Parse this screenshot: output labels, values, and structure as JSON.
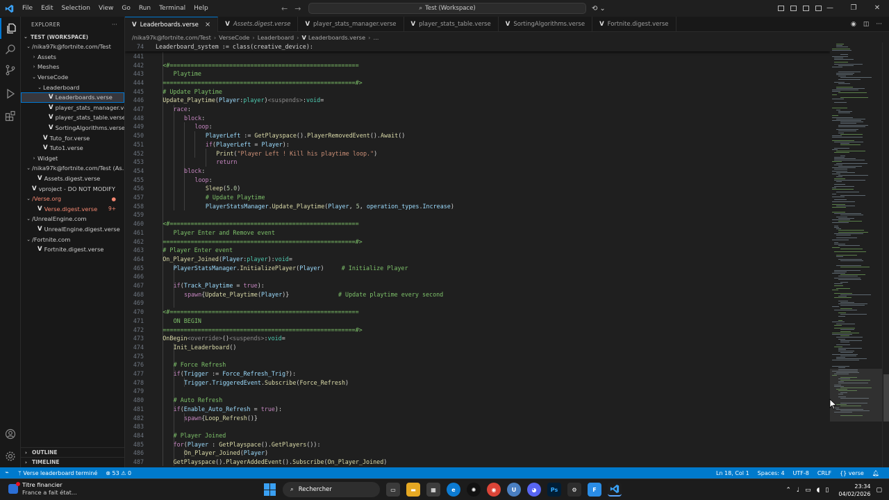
{
  "menu": [
    "File",
    "Edit",
    "Selection",
    "View",
    "Go",
    "Run",
    "Terminal",
    "Help"
  ],
  "search": {
    "text": "Test (Workspace)"
  },
  "sidebar": {
    "title": "EXPLORER",
    "more": "···",
    "workspace": "TEST (WORKSPACE)",
    "items": [
      {
        "label": "/nika97k@fortnite.com/Test",
        "indent": 1,
        "twisty": "open",
        "v": false
      },
      {
        "label": "Assets",
        "indent": 2,
        "twisty": "closed",
        "v": false
      },
      {
        "label": "Meshes",
        "indent": 2,
        "twisty": "closed",
        "v": false
      },
      {
        "label": "VerseCode",
        "indent": 2,
        "twisty": "open",
        "v": false
      },
      {
        "label": "Leaderboard",
        "indent": 3,
        "twisty": "open",
        "v": false
      },
      {
        "label": "Leaderboards.verse",
        "indent": 4,
        "twisty": "",
        "v": true,
        "selected": true
      },
      {
        "label": "player_stats_manager.verse",
        "indent": 4,
        "twisty": "",
        "v": true
      },
      {
        "label": "player_stats_table.verse",
        "indent": 4,
        "twisty": "",
        "v": true
      },
      {
        "label": "SortingAlgorithms.verse",
        "indent": 4,
        "twisty": "",
        "v": true
      },
      {
        "label": "Tuto_for.verse",
        "indent": 3,
        "twisty": "",
        "v": true
      },
      {
        "label": "Tuto1.verse",
        "indent": 3,
        "twisty": "",
        "v": true
      },
      {
        "label": "Widget",
        "indent": 2,
        "twisty": "closed",
        "v": false
      },
      {
        "label": "/nika97k@fortnite.com/Test (As...",
        "indent": 1,
        "twisty": "open",
        "v": false
      },
      {
        "label": "Assets.digest.verse",
        "indent": 2,
        "twisty": "",
        "v": true
      },
      {
        "label": "vproject - DO NOT MODIFY",
        "indent": 1,
        "twisty": "",
        "v": true
      },
      {
        "label": "/Verse.org",
        "indent": 1,
        "twisty": "open",
        "v": false,
        "error": true,
        "badge": "●"
      },
      {
        "label": "Verse.digest.verse",
        "indent": 2,
        "twisty": "",
        "v": true,
        "error": true,
        "badge": "9+"
      },
      {
        "label": "/UnrealEngine.com",
        "indent": 1,
        "twisty": "open",
        "v": false
      },
      {
        "label": "UnrealEngine.digest.verse",
        "indent": 2,
        "twisty": "",
        "v": true
      },
      {
        "label": "/Fortnite.com",
        "indent": 1,
        "twisty": "open",
        "v": false
      },
      {
        "label": "Fortnite.digest.verse",
        "indent": 2,
        "twisty": "",
        "v": true
      }
    ],
    "outline": "OUTLINE",
    "timeline": "TIMELINE"
  },
  "tabs": [
    {
      "label": "Leaderboards.verse",
      "active": true,
      "italic": false
    },
    {
      "label": "Assets.digest.verse",
      "active": false,
      "italic": true
    },
    {
      "label": "player_stats_manager.verse",
      "active": false,
      "italic": false
    },
    {
      "label": "player_stats_table.verse",
      "active": false,
      "italic": false
    },
    {
      "label": "SortingAlgorithms.verse",
      "active": false,
      "italic": false
    },
    {
      "label": "Fortnite.digest.verse",
      "active": false,
      "italic": false
    }
  ],
  "breadcrumb": [
    "/nika97k@fortnite.com/Test",
    "VerseCode",
    "Leaderboard",
    "Leaderboards.verse",
    "..."
  ],
  "sticky": {
    "num": "74",
    "code": "Leaderboard_system := class(creative_device):"
  },
  "lines": [
    {
      "n": "441",
      "t": [],
      "i": 0
    },
    {
      "n": "442",
      "t": [
        [
          "g",
          "<#======================================================"
        ]
      ],
      "i": 2
    },
    {
      "n": "443",
      "t": [
        [
          "g",
          "Playtime"
        ]
      ],
      "i": 5
    },
    {
      "n": "444",
      "t": [
        [
          "g",
          "=======================================================#>"
        ]
      ],
      "i": 2
    },
    {
      "n": "445",
      "t": [
        [
          "g",
          "# Update Playtime"
        ]
      ],
      "i": 2
    },
    {
      "n": "446",
      "t": [
        [
          "y",
          "Update_Playtime"
        ],
        [
          "w",
          "("
        ],
        [
          "c",
          "Player"
        ],
        [
          "w",
          ":"
        ],
        [
          "t",
          "player"
        ],
        [
          "w",
          ")"
        ],
        [
          "q",
          "<suspends>"
        ],
        [
          "w",
          ":"
        ],
        [
          "t",
          "void"
        ],
        [
          "w",
          "="
        ]
      ],
      "i": 2
    },
    {
      "n": "447",
      "t": [
        [
          "k",
          "race"
        ],
        [
          "w",
          ":"
        ]
      ],
      "i": 5
    },
    {
      "n": "448",
      "t": [
        [
          "k",
          "block"
        ],
        [
          "w",
          ":"
        ]
      ],
      "i": 8
    },
    {
      "n": "449",
      "t": [
        [
          "k",
          "loop"
        ],
        [
          "w",
          ":"
        ]
      ],
      "i": 11
    },
    {
      "n": "450",
      "t": [
        [
          "c",
          "PlayerLeft"
        ],
        [
          "w",
          " := "
        ],
        [
          "y",
          "GetPlayspace"
        ],
        [
          "w",
          "()."
        ],
        [
          "y",
          "PlayerRemovedEvent"
        ],
        [
          "w",
          "()."
        ],
        [
          "y",
          "Await"
        ],
        [
          "w",
          "()"
        ]
      ],
      "i": 14
    },
    {
      "n": "451",
      "t": [
        [
          "k",
          "if"
        ],
        [
          "w",
          "("
        ],
        [
          "c",
          "PlayerLeft"
        ],
        [
          "w",
          " = "
        ],
        [
          "c",
          "Player"
        ],
        [
          "w",
          "):"
        ]
      ],
      "i": 14
    },
    {
      "n": "452",
      "t": [
        [
          "y",
          "Print"
        ],
        [
          "w",
          "("
        ],
        [
          "s",
          "\"Player Left ! Kill his playtime loop.\""
        ],
        [
          "w",
          ")"
        ]
      ],
      "i": 17
    },
    {
      "n": "453",
      "t": [
        [
          "k",
          "return"
        ]
      ],
      "i": 17
    },
    {
      "n": "454",
      "t": [
        [
          "k",
          "block"
        ],
        [
          "w",
          ":"
        ]
      ],
      "i": 8
    },
    {
      "n": "455",
      "t": [
        [
          "k",
          "loop"
        ],
        [
          "w",
          ":"
        ]
      ],
      "i": 11
    },
    {
      "n": "456",
      "t": [
        [
          "y",
          "Sleep"
        ],
        [
          "w",
          "("
        ],
        [
          "n",
          "5.0"
        ],
        [
          "w",
          ")"
        ]
      ],
      "i": 14
    },
    {
      "n": "457",
      "t": [
        [
          "g",
          "# Update Playtime"
        ]
      ],
      "i": 14
    },
    {
      "n": "458",
      "t": [
        [
          "c",
          "PlayerStatsManager"
        ],
        [
          "w",
          "."
        ],
        [
          "y",
          "Update_Playtime"
        ],
        [
          "w",
          "("
        ],
        [
          "c",
          "Player"
        ],
        [
          "w",
          ", "
        ],
        [
          "n",
          "5"
        ],
        [
          "w",
          ", "
        ],
        [
          "c",
          "operation_types"
        ],
        [
          "w",
          "."
        ],
        [
          "c",
          "Increase"
        ],
        [
          "w",
          ")"
        ]
      ],
      "i": 14
    },
    {
      "n": "459",
      "t": [],
      "i": 0
    },
    {
      "n": "460",
      "t": [
        [
          "g",
          "<#======================================================"
        ]
      ],
      "i": 2
    },
    {
      "n": "461",
      "t": [
        [
          "g",
          "Player Enter and Remove event"
        ]
      ],
      "i": 5
    },
    {
      "n": "462",
      "t": [
        [
          "g",
          "=======================================================#>"
        ]
      ],
      "i": 2
    },
    {
      "n": "463",
      "t": [
        [
          "g",
          "# Player Enter event"
        ]
      ],
      "i": 2
    },
    {
      "n": "464",
      "t": [
        [
          "y",
          "On_Player_Joined"
        ],
        [
          "w",
          "("
        ],
        [
          "c",
          "Player"
        ],
        [
          "w",
          ":"
        ],
        [
          "t",
          "player"
        ],
        [
          "w",
          "):"
        ],
        [
          "t",
          "void"
        ],
        [
          "w",
          "="
        ]
      ],
      "i": 2
    },
    {
      "n": "465",
      "t": [
        [
          "c",
          "PlayerStatsManager"
        ],
        [
          "w",
          "."
        ],
        [
          "y",
          "InitializePlayer"
        ],
        [
          "w",
          "("
        ],
        [
          "c",
          "Player"
        ],
        [
          "w",
          ")     "
        ],
        [
          "g",
          "# Initialize Player"
        ]
      ],
      "i": 5
    },
    {
      "n": "466",
      "t": [],
      "i": 0
    },
    {
      "n": "467",
      "t": [
        [
          "k",
          "if"
        ],
        [
          "w",
          "("
        ],
        [
          "c",
          "Track_Playtime"
        ],
        [
          "w",
          " = "
        ],
        [
          "k",
          "true"
        ],
        [
          "w",
          "):"
        ]
      ],
      "i": 5
    },
    {
      "n": "468",
      "t": [
        [
          "k",
          "spawn"
        ],
        [
          "w",
          "{"
        ],
        [
          "y",
          "Update_Playtime"
        ],
        [
          "w",
          "("
        ],
        [
          "c",
          "Player"
        ],
        [
          "w",
          ")}              "
        ],
        [
          "g",
          "# Update playtime every second"
        ]
      ],
      "i": 8
    },
    {
      "n": "469",
      "t": [],
      "i": 0
    },
    {
      "n": "470",
      "t": [
        [
          "g",
          "<#======================================================"
        ]
      ],
      "i": 2
    },
    {
      "n": "471",
      "t": [
        [
          "g",
          "ON BEGIN"
        ]
      ],
      "i": 5
    },
    {
      "n": "472",
      "t": [
        [
          "g",
          "=======================================================#>"
        ]
      ],
      "i": 2
    },
    {
      "n": "473",
      "t": [
        [
          "y",
          "OnBegin"
        ],
        [
          "q",
          "<override>"
        ],
        [
          "w",
          "()"
        ],
        [
          "q",
          "<suspends>"
        ],
        [
          "w",
          ":"
        ],
        [
          "t",
          "void"
        ],
        [
          "w",
          "="
        ]
      ],
      "i": 2
    },
    {
      "n": "474",
      "t": [
        [
          "y",
          "Init_Leaderboard"
        ],
        [
          "w",
          "()"
        ]
      ],
      "i": 5
    },
    {
      "n": "475",
      "t": [],
      "i": 0
    },
    {
      "n": "476",
      "t": [
        [
          "g",
          "# Force Refresh"
        ]
      ],
      "i": 5
    },
    {
      "n": "477",
      "t": [
        [
          "k",
          "if"
        ],
        [
          "w",
          "("
        ],
        [
          "c",
          "Trigger"
        ],
        [
          "w",
          " := "
        ],
        [
          "c",
          "Force_Refresh_Trig"
        ],
        [
          "w",
          "?):"
        ]
      ],
      "i": 5
    },
    {
      "n": "478",
      "t": [
        [
          "c",
          "Trigger"
        ],
        [
          "w",
          "."
        ],
        [
          "c",
          "TriggeredEvent"
        ],
        [
          "w",
          "."
        ],
        [
          "y",
          "Subscribe"
        ],
        [
          "w",
          "("
        ],
        [
          "y",
          "Force_Refresh"
        ],
        [
          "w",
          ")"
        ]
      ],
      "i": 8
    },
    {
      "n": "479",
      "t": [],
      "i": 0
    },
    {
      "n": "480",
      "t": [
        [
          "g",
          "# Auto Refresh"
        ]
      ],
      "i": 5
    },
    {
      "n": "481",
      "t": [
        [
          "k",
          "if"
        ],
        [
          "w",
          "("
        ],
        [
          "c",
          "Enable_Auto_Refresh"
        ],
        [
          "w",
          " = "
        ],
        [
          "k",
          "true"
        ],
        [
          "w",
          "):"
        ]
      ],
      "i": 5
    },
    {
      "n": "482",
      "t": [
        [
          "k",
          "spawn"
        ],
        [
          "w",
          "{"
        ],
        [
          "y",
          "Loop_Refresh"
        ],
        [
          "w",
          "()}"
        ]
      ],
      "i": 8
    },
    {
      "n": "483",
      "t": [],
      "i": 0
    },
    {
      "n": "484",
      "t": [
        [
          "g",
          "# Player Joined"
        ]
      ],
      "i": 5
    },
    {
      "n": "485",
      "t": [
        [
          "k",
          "for"
        ],
        [
          "w",
          "("
        ],
        [
          "c",
          "Player"
        ],
        [
          "w",
          " : "
        ],
        [
          "y",
          "GetPlayspace"
        ],
        [
          "w",
          "()."
        ],
        [
          "y",
          "GetPlayers"
        ],
        [
          "w",
          "()):"
        ]
      ],
      "i": 5
    },
    {
      "n": "486",
      "t": [
        [
          "y",
          "On_Player_Joined"
        ],
        [
          "w",
          "("
        ],
        [
          "c",
          "Player"
        ],
        [
          "w",
          ")"
        ]
      ],
      "i": 8
    },
    {
      "n": "487",
      "t": [
        [
          "y",
          "GetPlayspace"
        ],
        [
          "w",
          "()."
        ],
        [
          "y",
          "PlayerAddedEvent"
        ],
        [
          "w",
          "()."
        ],
        [
          "y",
          "Subscribe"
        ],
        [
          "w",
          "("
        ],
        [
          "y",
          "On_Player_Joined"
        ],
        [
          "w",
          ")"
        ]
      ],
      "i": 5
    }
  ],
  "status": {
    "branch": "Verse leaderboard terminé",
    "problems": "53",
    "warnings": "0",
    "position": "Ln 18, Col 1",
    "spaces": "Spaces: 4",
    "encoding": "UTF-8",
    "eol": "CRLF",
    "lang": "verse"
  },
  "taskbar": {
    "news_title": "Titre financier",
    "news_sub": "France a fait état...",
    "search": "Rechercher",
    "time": "23:34",
    "date": "04/02/2026"
  }
}
